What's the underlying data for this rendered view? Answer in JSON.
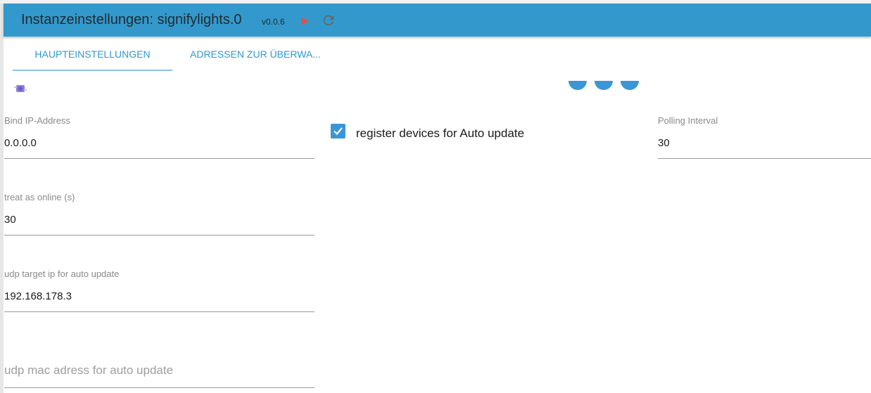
{
  "header": {
    "title": "Instanzeinstellungen: signifylights.0",
    "version": "v0.0.6",
    "background": "#3399cc",
    "play_color": "#d9534f"
  },
  "tabs": [
    {
      "label": "HAUPTEINSTELLUNGEN",
      "active": true
    },
    {
      "label": "ADRESSEN ZUR ÜBERWA..."
    }
  ],
  "fields": {
    "bind_ip": {
      "label": "Bind IP-Address",
      "value": "0.0.0.0"
    },
    "polling_interval": {
      "label": "Polling Interval",
      "value": "30"
    },
    "treat_online": {
      "label": "treat as online (s)",
      "value": "30"
    },
    "udp_target_ip": {
      "label": "udp target ip for auto update",
      "value": "192.168.178.3"
    },
    "udp_mac": {
      "placeholder": "udp mac adress for auto update",
      "value": ""
    }
  },
  "auto_update_checkbox": {
    "label": "register devices for Auto update",
    "checked": true,
    "color": "#3a96d6"
  },
  "icons": {
    "play": "play-icon",
    "reload": "reload-icon",
    "logo": "adapter-logo-icon",
    "check": "checkmark-icon"
  }
}
